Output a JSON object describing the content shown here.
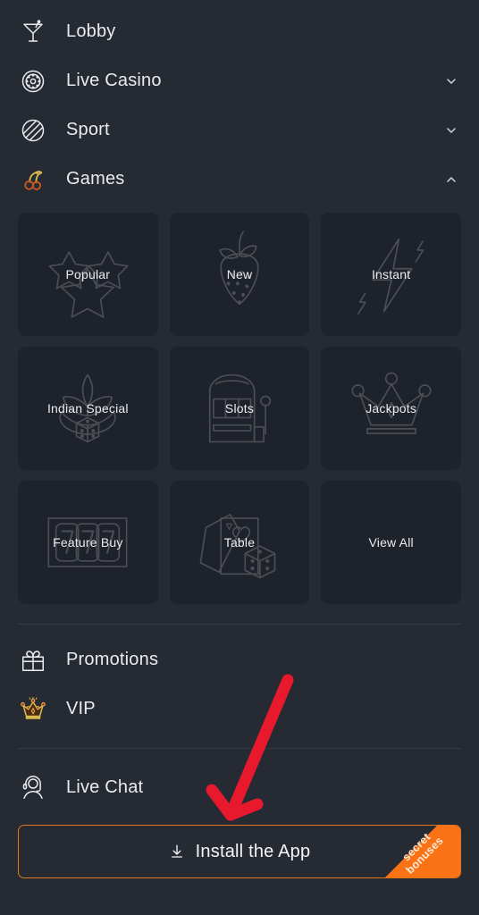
{
  "theme": {
    "background": "#252a33",
    "tile_background": "#1e222a",
    "text": "#e9ecef",
    "divider": "#333a45",
    "accent_orange": "#e2761b",
    "ribbon_orange": "#f97316",
    "annotation_red": "#e8192c",
    "vip_gold": "#d8b84a",
    "cherry_red": "#c8561f"
  },
  "nav": {
    "items": [
      {
        "label": "Lobby",
        "icon": "martini-glass-icon",
        "chevron": "none"
      },
      {
        "label": "Live Casino",
        "icon": "poker-chip-icon",
        "chevron": "down"
      },
      {
        "label": "Sport",
        "icon": "sport-ball-icon",
        "chevron": "down"
      },
      {
        "label": "Games",
        "icon": "cherries-icon",
        "chevron": "up"
      }
    ]
  },
  "games_grid": {
    "tiles": [
      {
        "label": "Popular",
        "icon": "stars-icon"
      },
      {
        "label": "New",
        "icon": "strawberry-icon"
      },
      {
        "label": "Instant",
        "icon": "lightning-bolt-icon"
      },
      {
        "label": "Indian Special",
        "icon": "lotus-dice-icon"
      },
      {
        "label": "Slots",
        "icon": "slot-machine-icon"
      },
      {
        "label": "Jackpots",
        "icon": "crown-icon"
      },
      {
        "label": "Feature Buy",
        "icon": "seven-seven-seven-icon"
      },
      {
        "label": "Table",
        "icon": "cards-dice-icon"
      },
      {
        "label": "View All",
        "icon": "none"
      }
    ]
  },
  "secondary_nav": {
    "items": [
      {
        "label": "Promotions",
        "icon": "gift-icon"
      },
      {
        "label": "VIP",
        "icon": "vip-crown-icon"
      }
    ]
  },
  "support_nav": {
    "items": [
      {
        "label": "Live Chat",
        "icon": "headset-icon"
      }
    ]
  },
  "install": {
    "label": "Install the App",
    "icon": "download-icon",
    "ribbon_line1": "secret",
    "ribbon_line2": "bonuses"
  }
}
